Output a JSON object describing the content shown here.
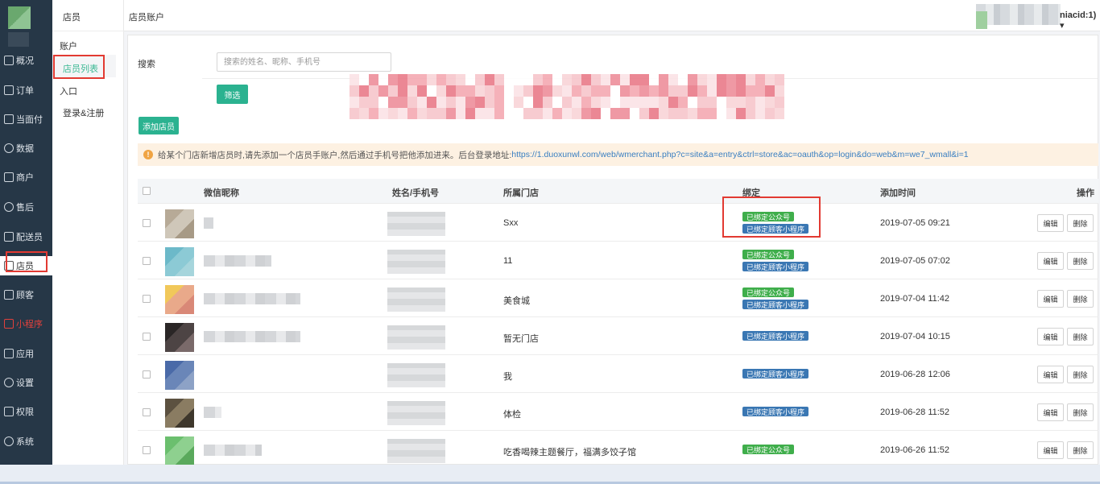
{
  "nav": {
    "items": [
      {
        "label": "概况",
        "icon": "grid-icon"
      },
      {
        "label": "订单",
        "icon": "list-icon"
      },
      {
        "label": "当面付",
        "icon": "doc-icon"
      },
      {
        "label": "数据",
        "icon": "chart-icon"
      },
      {
        "label": "商户",
        "icon": "store-icon"
      },
      {
        "label": "售后",
        "icon": "service-icon"
      },
      {
        "label": "配送员",
        "icon": "user-icon"
      },
      {
        "label": "店员",
        "icon": "person-icon"
      },
      {
        "label": "顾客",
        "icon": "customer-icon"
      },
      {
        "label": "小程序",
        "icon": "miniapp-icon"
      },
      {
        "label": "应用",
        "icon": "apps-icon"
      },
      {
        "label": "设置",
        "icon": "gear-icon"
      },
      {
        "label": "权限",
        "icon": "lock-icon"
      },
      {
        "label": "系统",
        "icon": "system-icon"
      }
    ]
  },
  "subnav": {
    "title": "店员",
    "items": [
      "账户",
      "店员列表",
      "入口",
      "登录&注册"
    ]
  },
  "header": {
    "breadcrumb": "店员账户",
    "user_suffix": "niacid:1)"
  },
  "search": {
    "label": "搜索",
    "placeholder": "搜索的姓名、昵称、手机号",
    "filter_button": "筛选"
  },
  "add_button": "添加店员",
  "notice": {
    "text": "给某个门店新增店员时,请先添加一个店员手账户,然后通过手机号把他添加进来。后台登录地址:",
    "link": "https://1.duoxunwl.com/web/wmerchant.php?c=site&a=entry&ctrl=store&ac=oauth&op=login&do=web&m=we7_wmall&i=1"
  },
  "table": {
    "columns": [
      "微信昵称",
      "姓名/手机号",
      "所属门店",
      "绑定",
      "添加时间",
      "操作"
    ],
    "edit_label": "编辑",
    "delete_label": "删除",
    "rows": [
      {
        "store": "Sxx",
        "badges": [
          "已绑定公众号",
          "已绑定顾客小程序"
        ],
        "time": "2019-07-05 09:21",
        "avatar_colors": [
          "#b7aa97",
          "#cfc7b9",
          "#a79a86"
        ]
      },
      {
        "store": "11",
        "badges": [
          "已绑定公众号",
          "已绑定顾客小程序"
        ],
        "time": "2019-07-05 07:02",
        "avatar_colors": [
          "#6cb9c9",
          "#8ccad5",
          "#a6d5dc"
        ]
      },
      {
        "store": "美食城",
        "badges": [
          "已绑定公众号",
          "已绑定顾客小程序"
        ],
        "time": "2019-07-04 11:42",
        "avatar_colors": [
          "#f1c85a",
          "#e9a98a",
          "#d98877"
        ]
      },
      {
        "store": "暂无门店",
        "badges": [
          "已绑定顾客小程序"
        ],
        "time": "2019-07-04 10:15",
        "avatar_colors": [
          "#2a2626",
          "#4d4444",
          "#7a6a6a"
        ]
      },
      {
        "store": "我",
        "badges": [
          "已绑定顾客小程序"
        ],
        "time": "2019-06-28 12:06",
        "avatar_colors": [
          "#4a6aa8",
          "#6a86b8",
          "#8da2c6"
        ]
      },
      {
        "store": "体检",
        "badges": [
          "已绑定顾客小程序"
        ],
        "time": "2019-06-28 11:52",
        "avatar_colors": [
          "#5c5140",
          "#8a7c62",
          "#3e372c"
        ]
      },
      {
        "store": "吃香喝辣主题餐厅，福满多饺子馆",
        "badges": [
          "已绑定公众号"
        ],
        "time": "2019-06-26 11:52",
        "avatar_colors": [
          "#6bbf6e",
          "#8ed08f",
          "#5aa95c"
        ]
      }
    ]
  },
  "colors": {
    "nav_bg": "#263747",
    "accent": "#2bb290",
    "badge_green": "#3fae4b",
    "badge_blue": "#3a77b3",
    "highlight": "#e23a32"
  }
}
